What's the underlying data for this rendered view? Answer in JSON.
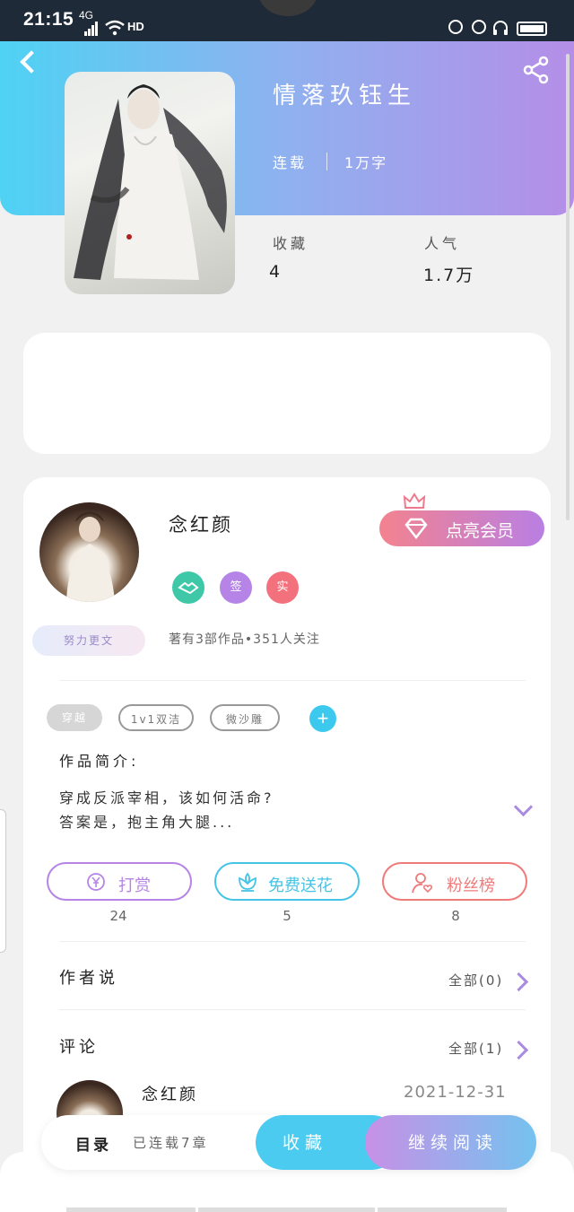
{
  "status_bar": {
    "time": "21:15",
    "network": "4G",
    "hd": "HD"
  },
  "book": {
    "title": "情落玖钰生",
    "status": "连载",
    "words": "1万字",
    "stats": [
      {
        "label": "收藏",
        "value": "4"
      },
      {
        "label": "人气",
        "value": "1.7万"
      }
    ]
  },
  "author": {
    "name": "念红颜",
    "badges": [
      {
        "icon": "handshake-icon",
        "text": "",
        "color": "#3ec8a8"
      },
      {
        "icon": "signed-icon",
        "text": "签",
        "color": "#b584e6"
      },
      {
        "icon": "real-icon",
        "text": "实",
        "color": "#f2717d"
      }
    ],
    "vip_button": "点亮会员",
    "effort_badge": "努力更文",
    "works_summary": "著有3部作品•351人关注"
  },
  "tags": [
    "穿越",
    "1v1双洁",
    "微沙雕"
  ],
  "intro": {
    "label": "作品简介:",
    "lines": [
      "穿成反派宰相，该如何活命?",
      "答案是，抱主角大腿..."
    ]
  },
  "actions": [
    {
      "label": "打赏",
      "count": "24",
      "icon": "yen-icon",
      "color": "#b584e6"
    },
    {
      "label": "免费送花",
      "count": "5",
      "icon": "flower-icon",
      "color": "#46c4e6"
    },
    {
      "label": "粉丝榜",
      "count": "8",
      "icon": "fans-icon",
      "color": "#ef7a7a"
    }
  ],
  "author_says": {
    "title": "作者说",
    "all": "全部(0)"
  },
  "comments": {
    "title": "评论",
    "all": "全部(1)",
    "items": [
      {
        "name": "念红颜",
        "date": "2021-12-31"
      }
    ]
  },
  "bottom_bar": {
    "toc_label": "目录",
    "toc_status": "已连载7章",
    "collect": "收藏",
    "read": "继续阅读"
  },
  "colors": {
    "header_start": "#4fd2f4",
    "header_end": "#b58ee8",
    "accent_purple": "#a98be0"
  }
}
